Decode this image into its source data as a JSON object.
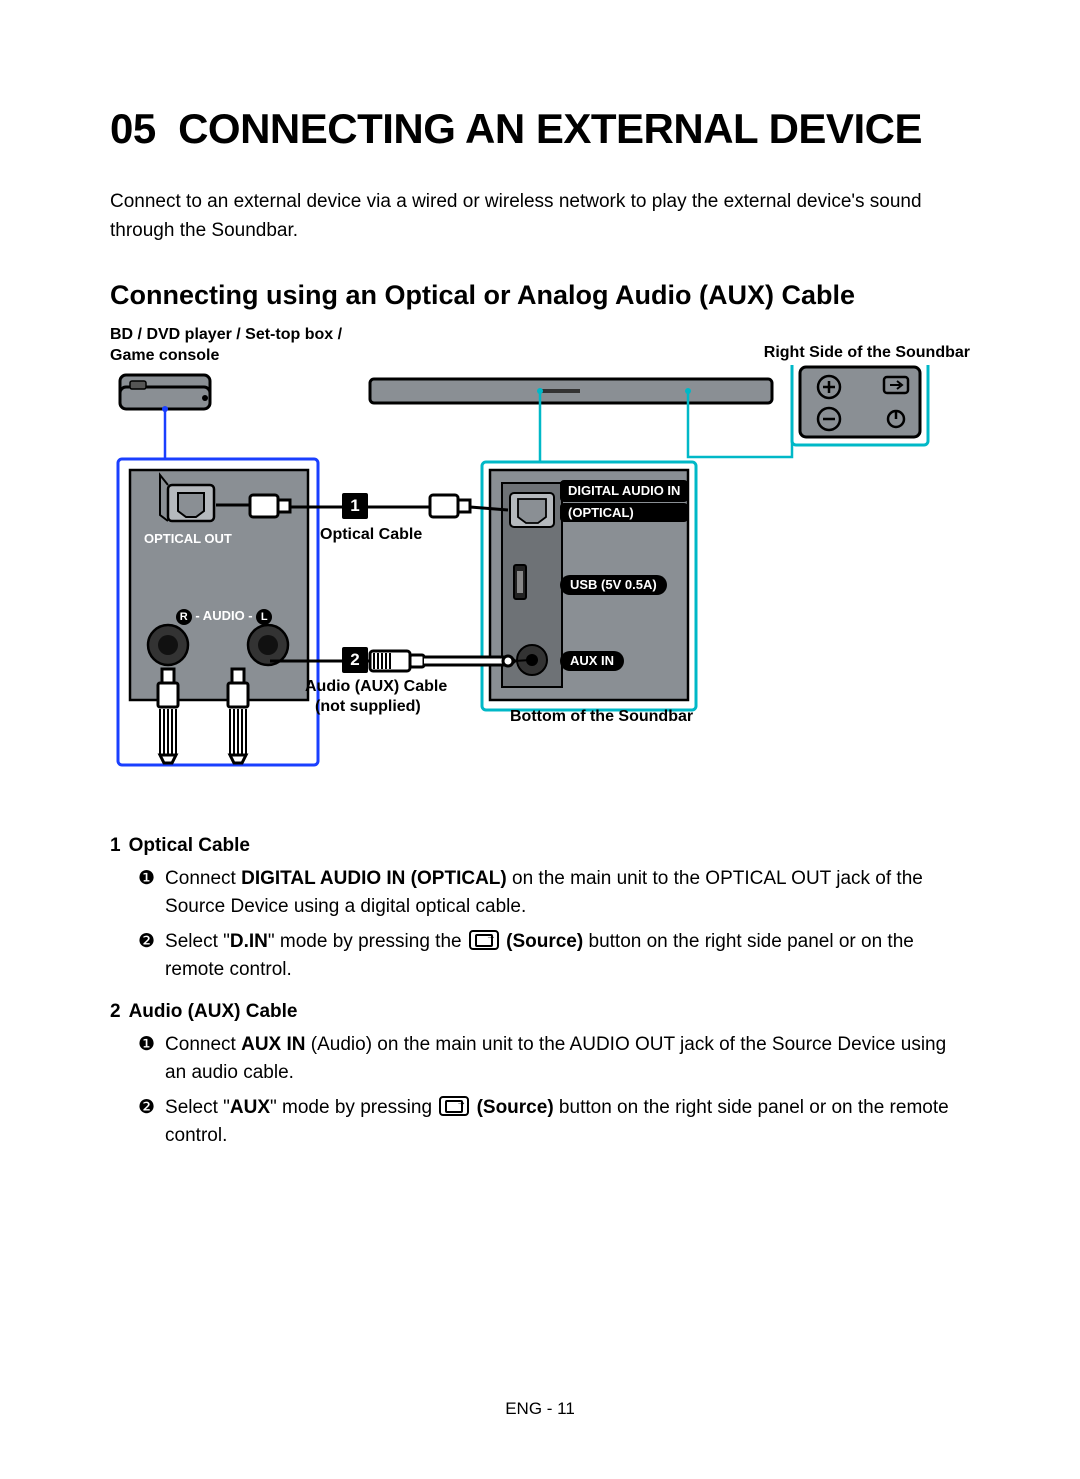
{
  "chapter": {
    "number": "05",
    "title": "CONNECTING AN EXTERNAL DEVICE",
    "intro": "Connect to an external device via a wired or wireless network to play the external device's sound through the Soundbar."
  },
  "section": {
    "title": "Connecting using an Optical or Analog Audio (AUX) Cable"
  },
  "diagram": {
    "label_source": "BD / DVD player / Set-top box / Game console",
    "label_right_side": "Right Side of the Soundbar",
    "label_optical_out": "OPTICAL OUT",
    "label_optical_cable": "Optical Cable",
    "label_digital_in_1": "DIGITAL AUDIO IN",
    "label_digital_in_2": "(OPTICAL)",
    "label_usb": "USB (5V 0.5A)",
    "label_aux_in": "AUX IN",
    "label_audio_rl_r": "R",
    "label_audio_rl_mid": " - AUDIO - ",
    "label_audio_rl_l": "L",
    "label_aux_cable_1": "Audio (AUX) Cable",
    "label_aux_cable_2": "(not supplied)",
    "label_bottom": "Bottom of the Soundbar",
    "callout_1": "1",
    "callout_2": "2"
  },
  "instructions": {
    "item1": {
      "num": "1",
      "heading": "Optical Cable",
      "step1": {
        "bullet": "❶",
        "pre": "Connect ",
        "bold": "DIGITAL AUDIO IN (OPTICAL)",
        "post": " on the main unit to the OPTICAL OUT jack of the Source Device using a digital optical cable."
      },
      "step2": {
        "bullet": "❷",
        "pre": "Select \"",
        "bold1": "D.IN",
        "mid": "\" mode by pressing the ",
        "bold2": " (Source)",
        "post": " button on the right side panel or on the remote control."
      }
    },
    "item2": {
      "num": "2",
      "heading": "Audio (AUX) Cable",
      "step1": {
        "bullet": "❶",
        "pre": "Connect ",
        "bold": "AUX IN",
        "post": " (Audio) on the main unit to the AUDIO OUT jack of the Source Device using an audio cable."
      },
      "step2": {
        "bullet": "❷",
        "pre": "Select \"",
        "bold1": "AUX",
        "mid": "\" mode by pressing ",
        "bold2": " (Source)",
        "post": " button on the right side panel or on the remote control."
      }
    }
  },
  "footer": "ENG - 11"
}
